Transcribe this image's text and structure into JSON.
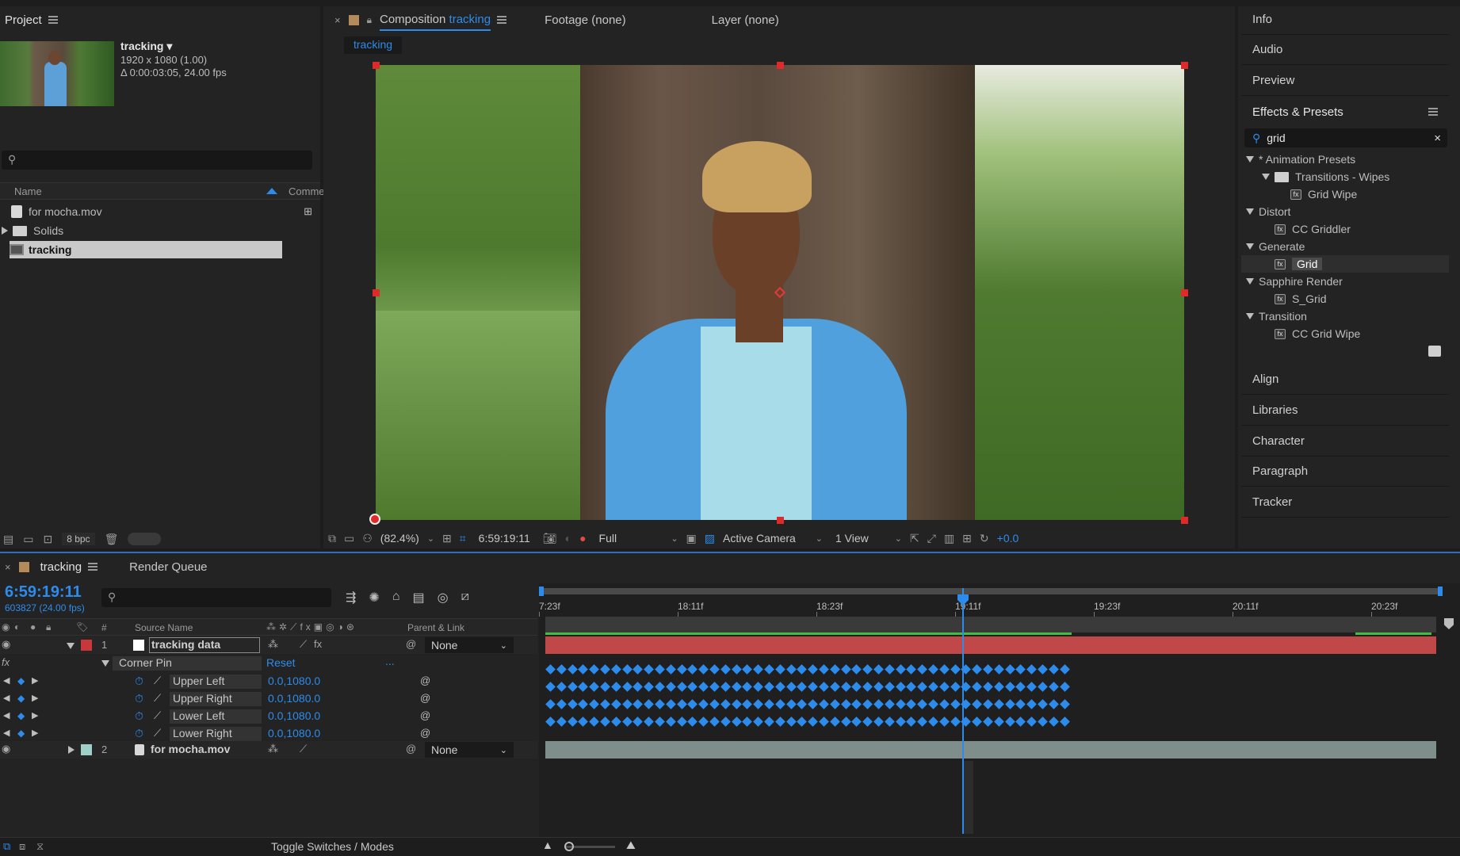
{
  "project": {
    "title": "Project",
    "comp_name": "tracking ▾",
    "comp_size": "1920 x 1080 (1.00)",
    "comp_duration": "Δ 0:00:03:05, 24.00 fps",
    "search_placeholder": "",
    "col_name": "Name",
    "col_comment": "Comme",
    "items": [
      {
        "label": "for mocha.mov",
        "type": "footage"
      },
      {
        "label": "Solids",
        "type": "folder"
      },
      {
        "label": "tracking",
        "type": "comp",
        "selected": true
      }
    ],
    "bpc": "8 bpc"
  },
  "viewer": {
    "tab_comp_prefix": "Composition",
    "tab_comp_name": "tracking",
    "tab_footage": "Footage (none)",
    "tab_layer": "Layer (none)",
    "breadcrumb": "tracking",
    "zoom": "(82.4%)",
    "timecode": "6:59:19:11",
    "resolution": "Full",
    "camera": "Active Camera",
    "views": "1 View",
    "exposure": "+0.0"
  },
  "right_panel": {
    "top_items": [
      "Info",
      "Audio",
      "Preview"
    ],
    "effects_title": "Effects & Presets",
    "search_value": "grid",
    "tree": [
      {
        "label": "* Animation Presets",
        "level": 0,
        "kind": "group"
      },
      {
        "label": "Transitions - Wipes",
        "level": 1,
        "kind": "folder"
      },
      {
        "label": "Grid Wipe",
        "level": 2,
        "kind": "effect"
      },
      {
        "label": "Distort",
        "level": 0,
        "kind": "group"
      },
      {
        "label": "CC Griddler",
        "level": 2,
        "kind": "effect"
      },
      {
        "label": "Generate",
        "level": 0,
        "kind": "group"
      },
      {
        "label": "Grid",
        "level": 2,
        "kind": "effect",
        "selected": true
      },
      {
        "label": "Sapphire Render",
        "level": 0,
        "kind": "group"
      },
      {
        "label": "S_Grid",
        "level": 2,
        "kind": "effect"
      },
      {
        "label": "Transition",
        "level": 0,
        "kind": "group"
      },
      {
        "label": "CC Grid Wipe",
        "level": 2,
        "kind": "effect"
      }
    ],
    "bottom_items": [
      "Align",
      "Libraries",
      "Character",
      "Paragraph",
      "Tracker"
    ]
  },
  "timeline": {
    "tab_name": "tracking",
    "tab_render": "Render Queue",
    "timecode": "6:59:19:11",
    "frames": "603827 (24.00 fps)",
    "col_num": "#",
    "col_source": "Source Name",
    "col_parent": "Parent & Link",
    "ruler_labels": [
      "7:23f",
      "18:11f",
      "18:23f",
      "19:11f",
      "19:23f",
      "20:11f",
      "20:23f"
    ],
    "layers": [
      {
        "num": "1",
        "name": "tracking data",
        "parent": "None",
        "color": "#c8383a"
      },
      {
        "num": "2",
        "name": "for mocha.mov",
        "parent": "None",
        "color": "#9fd0c8"
      }
    ],
    "effect_name": "Corner Pin",
    "effect_reset": "Reset",
    "effect_dots": "...",
    "props": [
      {
        "label": "Upper Left",
        "value": "0.0,1080.0"
      },
      {
        "label": "Upper Right",
        "value": "0.0,1080.0"
      },
      {
        "label": "Lower Left",
        "value": "0.0,1080.0"
      },
      {
        "label": "Lower Right",
        "value": "0.0,1080.0"
      }
    ],
    "toggle_label": "Toggle Switches / Modes"
  },
  "colors": {
    "accent": "#2d8ceb",
    "layer_red": "#c8383a",
    "layer_teal": "#9fd0c8",
    "handle_red": "#e02a2a"
  }
}
